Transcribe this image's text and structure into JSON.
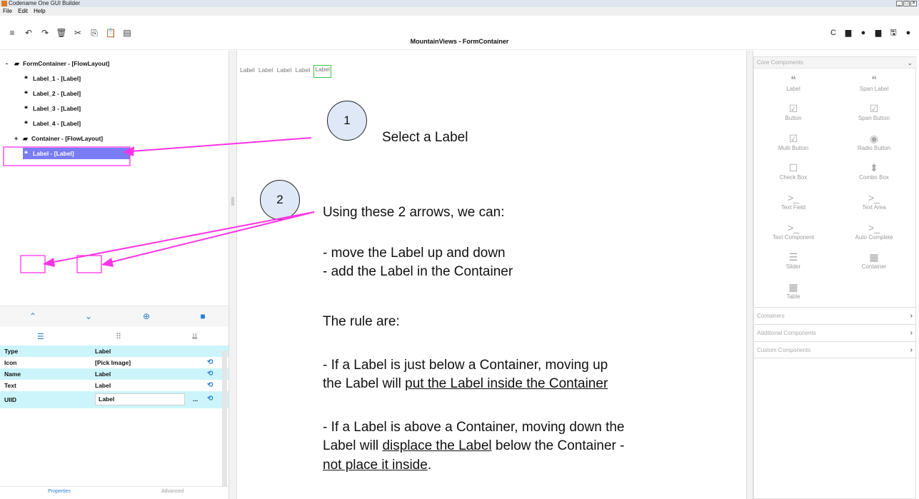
{
  "window": {
    "title": "Codename One GUI Builder"
  },
  "menu": [
    "File",
    "Edit",
    "Help"
  ],
  "toolbar": {
    "title": "MountainViews - FormContainer",
    "left_icons": [
      "≡",
      "↶",
      "↷",
      "🗑",
      "✂",
      "⎘",
      "📋",
      "▤"
    ],
    "right_icons": [
      "C",
      "▆",
      "●",
      "▆",
      "🖫",
      "●"
    ]
  },
  "tree": {
    "root": "FormContainer - [FlowLayout]",
    "items": [
      "Label_1 - [Label]",
      "Label_2 - [Label]",
      "Label_3 - [Label]",
      "Label_4 - [Label]",
      "Container - [FlowLayout]",
      "Label - [Label]"
    ]
  },
  "properties": {
    "tabs": [
      "Properties",
      "Advanced"
    ],
    "rows": [
      {
        "key": "Type",
        "value": "Label"
      },
      {
        "key": "Icon",
        "value": "[Pick Image]"
      },
      {
        "key": "Name",
        "value": "Label"
      },
      {
        "key": "Text",
        "value": "Label"
      },
      {
        "key": "UIID",
        "value": "Label"
      }
    ],
    "uiid_dots": "..."
  },
  "canvas": {
    "labels": [
      "Label",
      "Label",
      "Label",
      "Label",
      "Label"
    ]
  },
  "annotations": {
    "step1_num": "1",
    "step1_text": "Select a Label",
    "step2_num": "2",
    "line1": "Using these 2 arrows, we can:",
    "line2": "- move the Label up and down",
    "line3": "- add the Label in the Container",
    "line4": "The rule are:",
    "line5": "- If a Label is just below a Container, moving up",
    "line6a": "the Label will ",
    "line6b": "put the Label inside the Container",
    "line7": "- If a Label is above a Container, moving down the",
    "line8a": "Label will ",
    "line8b": "displace the Label",
    "line8c": " below the Container -",
    "line9a": "not place it inside",
    "line9b": "."
  },
  "palette": {
    "header": "Core Components",
    "components": [
      {
        "label": "Label",
        "icon": "❝"
      },
      {
        "label": "Span Label",
        "icon": "❝"
      },
      {
        "label": "Button",
        "icon": "☑"
      },
      {
        "label": "Span Button",
        "icon": "☑"
      },
      {
        "label": "Multi Button",
        "icon": "☑"
      },
      {
        "label": "Radio Button",
        "icon": "◉"
      },
      {
        "label": "Check Box",
        "icon": "☐"
      },
      {
        "label": "Combo Box",
        "icon": "⬍"
      },
      {
        "label": "Text Field",
        "icon": ">_"
      },
      {
        "label": "Text Area",
        "icon": ">_"
      },
      {
        "label": "Text Component",
        "icon": ">_"
      },
      {
        "label": "Auto Complete",
        "icon": ">_"
      },
      {
        "label": "Slider",
        "icon": "☰"
      },
      {
        "label": "Container",
        "icon": "▦"
      },
      {
        "label": "Table",
        "icon": "▦"
      }
    ],
    "sections": [
      "Containers",
      "Additional Components",
      "Custom Components"
    ]
  },
  "colors": {
    "annotation_arrow": "#ff33e6",
    "selection": "#7a7cf5",
    "accent": "#2a7fd4",
    "row_alt": "#ccf5fb"
  }
}
